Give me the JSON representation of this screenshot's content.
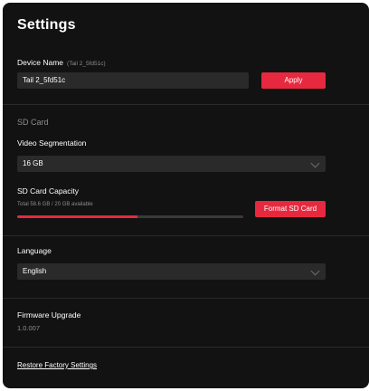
{
  "header": {
    "title": "Settings"
  },
  "device_name": {
    "label": "Device Name",
    "hint": "(Tail 2_5fd51c)",
    "value": "Tail 2_5fd51c",
    "apply_label": "Apply"
  },
  "sd_card": {
    "section_title": "SD Card",
    "segmentation_label": "Video Segmentation",
    "segmentation_value": "16 GB",
    "capacity_label": "SD Card Capacity",
    "capacity_text": "Total 58.6 GB / 20 GB available",
    "used_fraction": 0.53,
    "format_label": "Format SD Card"
  },
  "language": {
    "label": "Language",
    "value": "English"
  },
  "firmware": {
    "label": "Firmware Upgrade",
    "version": "1.0.007"
  },
  "restore": {
    "label": "Restore Factory Settings"
  },
  "colors": {
    "accent": "#e6293f",
    "background": "#121212",
    "field": "#2a2a2a"
  }
}
